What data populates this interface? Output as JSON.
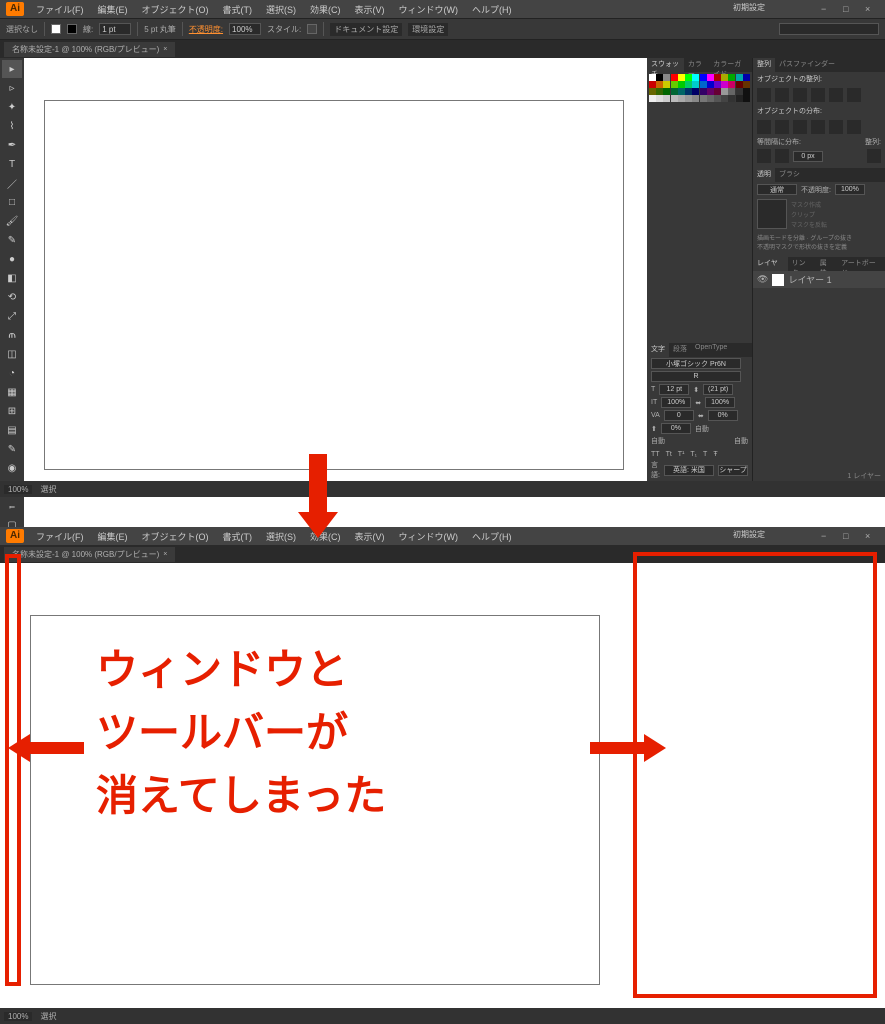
{
  "app": {
    "logo": "Ai"
  },
  "menu": {
    "file": "ファイル(F)",
    "edit": "編集(E)",
    "object": "オブジェクト(O)",
    "type": "書式(T)",
    "select": "選択(S)",
    "effect": "効果(C)",
    "view": "表示(V)",
    "window": "ウィンドウ(W)",
    "help": "ヘルプ(H)"
  },
  "essentials": "初期設定",
  "control": {
    "no_selection": "選択なし",
    "stroke_label": "線:",
    "stroke_width": "1 pt",
    "caps_label": "5 pt 丸筆",
    "opacity_label": "不透明度:",
    "opacity_value": "100%",
    "style_label": "スタイル:",
    "doc_setup": "ドキュメント設定",
    "env_setup": "環境設定"
  },
  "tab": {
    "name": "名称未設定-1 @ 100% (RGB/プレビュー)",
    "close": "×"
  },
  "status": {
    "zoom": "100%",
    "selection": "選択"
  },
  "panels": {
    "swatches_tab": "スウォッチ",
    "color_tab": "カラー",
    "guide_tab": "カラーガイド",
    "align_tab": "整列",
    "pathfinder_tab": "パスファインダー",
    "align_objects": "オブジェクトの整列:",
    "distribute_objects": "オブジェクトの分布:",
    "distribute_spacing": "等間隔に分布:",
    "align_to": "整列:",
    "spacing_value": "0 px",
    "trans_tab": "透明",
    "brush_tab": "ブラシ",
    "blend_mode": "通常",
    "opacity_label": "不透明度:",
    "opacity_value": "100%",
    "mask_make": "マスク作成",
    "clip": "クリップ",
    "invert_mask": "マスクを反転",
    "blend_note1": "描画モードを分離",
    "blend_note2": "グループの抜き",
    "blend_note3": "不透明マスクで形状の抜きを定義",
    "char_tab": "文字",
    "para_tab": "段落",
    "ot_tab": "OpenType",
    "font": "小塚ゴシック Pr6N",
    "font_style": "R",
    "size_value": "12 pt",
    "leading_value": "(21 pt)",
    "tracking_value": "100%",
    "kerning_value": "100%",
    "baseline_value": "0",
    "rotation_value": "0%",
    "auto": "自動",
    "lang_label": "言語:",
    "lang_value": "英語: 米国",
    "aa_label": "シャープ",
    "layers_tab": "レイヤー",
    "links_tab": "リンク",
    "attr_tab": "属性",
    "artboard_tab": "アートボード",
    "layer_name": "レイヤー 1",
    "layer_count": "1 レイヤー"
  },
  "annotation": {
    "line1": "ウィンドウと",
    "line2": "ツールバーが",
    "line3": "消えてしまった"
  }
}
